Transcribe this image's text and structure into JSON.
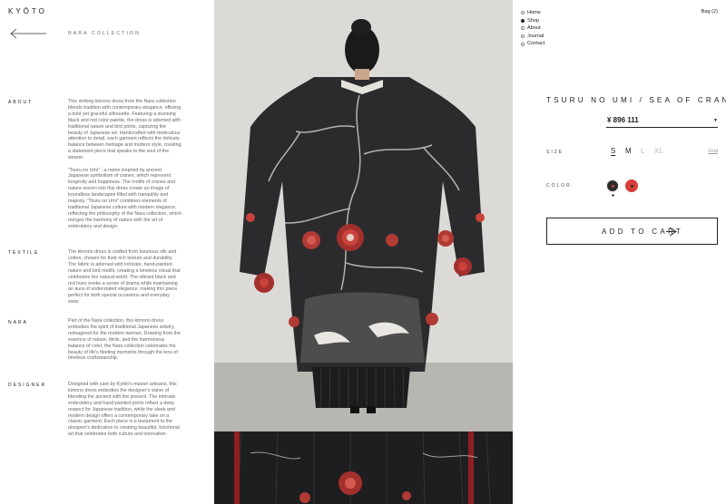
{
  "brand": {
    "logo": "KYŌTO"
  },
  "breadcrumb": {
    "collection": "NARA COLLECTION"
  },
  "sections": [
    {
      "title": "ABOUT",
      "paragraphs": [
        "This striking kimono dress from the Nara collection blends tradition with contemporary elegance, offering a bold yet graceful silhouette. Featuring a stunning black and red color palette, the dress is adorned with traditional nature and bird prints, capturing the beauty of Japanese art. Handcrafted with meticulous attention to detail, each garment reflects the delicate balance between heritage and modern style, creating a statement piece that speaks to the soul of the wearer.",
        "\"Tsuru no Umi\" - a name inspired by ancient Japanese symbolism of cranes, which represent longevity and happiness. The motifs of cranes and nature woven into this dress create an image of boundless landscapes filled with tranquility and majesty. \"Tsuru no Umi\" combines elements of traditional Japanese culture with modern elegance, reflecting the philosophy of the Nara collection, which merges the harmony of nature with the art of embroidery and design."
      ]
    },
    {
      "title": "TEXTILE",
      "paragraphs": [
        "The kimono dress is crafted from luxurious silk and cotton, chosen for their rich texture and durability. The fabric is adorned with intricate, hand-painted nature and bird motifs, creating a timeless visual that celebrates the natural world. The vibrant black and red hues evoke a sense of drama while maintaining an aura of understated elegance, making this piece perfect for both special occasions and everyday wear."
      ]
    },
    {
      "title": "NARA",
      "paragraphs": [
        "Part of the Nara collection, this kimono dress embodies the spirit of traditional Japanese artistry, reimagined for the modern woman. Drawing from the essence of nature, birds, and the harmonious balance of color, the Nara collection celebrates the beauty of life's fleeting moments through the lens of timeless craftsmanship."
      ]
    },
    {
      "title": "DESIGNER",
      "paragraphs": [
        "Designed with care by Kyōto's master artisans, this kimono dress embodies the designer's vision of blending the ancient with the present. The intricate embroidery and hand-painted prints reflect a deep respect for Japanese tradition, while the sleek and modern design offers a contemporary take on a classic garment. Each piece is a testament to the designer's dedication to creating beautiful, functional art that celebrates both culture and innovation."
      ]
    }
  ],
  "nav": {
    "items": [
      {
        "label": "Home",
        "active": false
      },
      {
        "label": "Shop",
        "active": true
      },
      {
        "label": "About",
        "active": false
      },
      {
        "label": "Journal",
        "active": false
      },
      {
        "label": "Contact",
        "active": false
      }
    ],
    "bag": "Bag (2)"
  },
  "product": {
    "title": "TSURU NO UMI / SEA OF CRANES",
    "price": "¥ 896 111",
    "size_label": "SIZE",
    "sizes": [
      {
        "label": "S",
        "available": true,
        "selected": true
      },
      {
        "label": "M",
        "available": true,
        "selected": false
      },
      {
        "label": "L",
        "available": false,
        "selected": false
      },
      {
        "label": "XL",
        "available": false,
        "selected": false
      }
    ],
    "size_grid": "Grid",
    "color_label": "COLOR",
    "colors": [
      {
        "name": "black",
        "hex": "#2a2a2a",
        "selected": true
      },
      {
        "name": "red",
        "hex": "#d93f3a",
        "selected": false
      }
    ],
    "add_to_cart": "ADD TO CART"
  },
  "accent": {
    "text": "#222222",
    "muted": "#666666",
    "red": "#d93f3a"
  }
}
